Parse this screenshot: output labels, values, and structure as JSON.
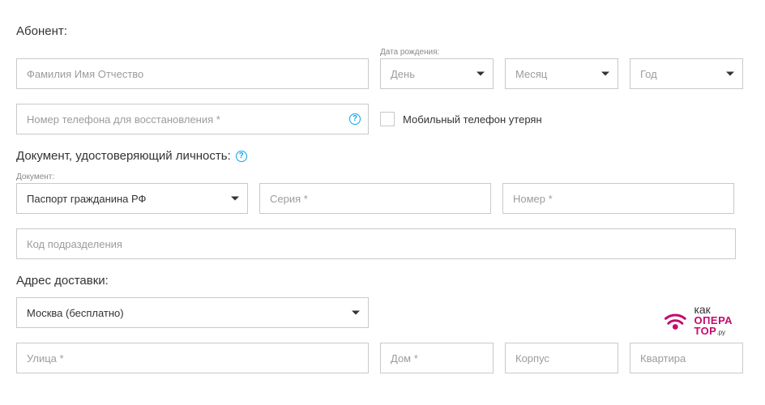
{
  "subscriber": {
    "title": "Абонент:",
    "fullname_placeholder": "Фамилия Имя Отчество",
    "birthdate_label": "Дата рождения:",
    "day_placeholder": "День",
    "month_placeholder": "Месяц",
    "year_placeholder": "Год",
    "phone_placeholder": "Номер телефона для восстановления *",
    "phone_lost_label": "Мобильный телефон утерян"
  },
  "document": {
    "title": "Документ, удостоверяющий личность:",
    "doc_label": "Документ:",
    "doc_value": "Паспорт гражданина РФ",
    "series_placeholder": "Серия *",
    "number_placeholder": "Номер *",
    "code_placeholder": "Код подразделения"
  },
  "delivery": {
    "title": "Адрес доставки:",
    "city_value": "Москва (бесплатно)",
    "street_placeholder": "Улица *",
    "house_placeholder": "Дом *",
    "building_placeholder": "Корпус",
    "flat_placeholder": "Квартира"
  },
  "logo": {
    "line1": "как",
    "line2": "ОПЕРА",
    "line3_a": "ТОР",
    "line3_b": ".ру"
  }
}
